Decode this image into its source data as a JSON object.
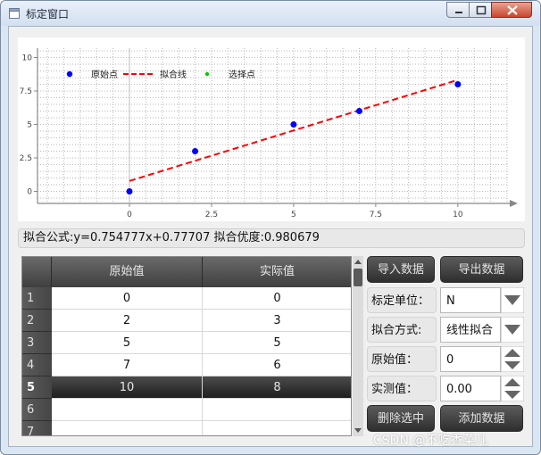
{
  "window": {
    "title": "标定窗口"
  },
  "chart_data": {
    "type": "scatter",
    "xlim": [
      -2.8,
      11.5
    ],
    "ylim": [
      -0.9,
      10.7
    ],
    "x_ticks": [
      "0",
      "2.5",
      "5",
      "7.5",
      "10"
    ],
    "y_ticks": [
      "0",
      "2.5",
      "5",
      "7.5",
      "10"
    ],
    "legend": [
      {
        "name": "原始点",
        "color": "#0000ff"
      },
      {
        "name": "拟合线",
        "color": "#ff0000"
      },
      {
        "name": "选择点",
        "color": "#00cc00"
      }
    ],
    "legend_placement": "top-left",
    "grid": true,
    "series": [
      {
        "name": "原始点",
        "points": [
          [
            0,
            0
          ],
          [
            2,
            3
          ],
          [
            5,
            5
          ],
          [
            7,
            6
          ],
          [
            10,
            8
          ]
        ]
      },
      {
        "name": "拟合线",
        "line": [
          [
            0,
            0.77707
          ],
          [
            10,
            8.32484
          ]
        ],
        "style": "dashed"
      }
    ]
  },
  "formula": "拟合公式:y=0.754777x+0.77707 拟合优度:0.980679",
  "table": {
    "headers": [
      "原始值",
      "实际值"
    ],
    "rows": [
      {
        "num": "1",
        "orig": "0",
        "actual": "0"
      },
      {
        "num": "2",
        "orig": "2",
        "actual": "3"
      },
      {
        "num": "3",
        "orig": "5",
        "actual": "5"
      },
      {
        "num": "4",
        "orig": "7",
        "actual": "6"
      },
      {
        "num": "5",
        "orig": "10",
        "actual": "8"
      },
      {
        "num": "6",
        "orig": "",
        "actual": ""
      },
      {
        "num": "7",
        "orig": "",
        "actual": ""
      }
    ],
    "selected_row": "5"
  },
  "buttons": {
    "import": "导入数据",
    "export": "导出数据",
    "delete": "删除选中",
    "add": "添加数据"
  },
  "form": {
    "unit_label": "标定单位：",
    "unit_value": "N",
    "method_label": "拟合方式:",
    "method_value": "线性拟合",
    "orig_label": "原始值：",
    "orig_value": "0",
    "measured_label": "实测值：",
    "measured_value": "0.00"
  },
  "watermark": "CSDN @不吃香菜儿"
}
